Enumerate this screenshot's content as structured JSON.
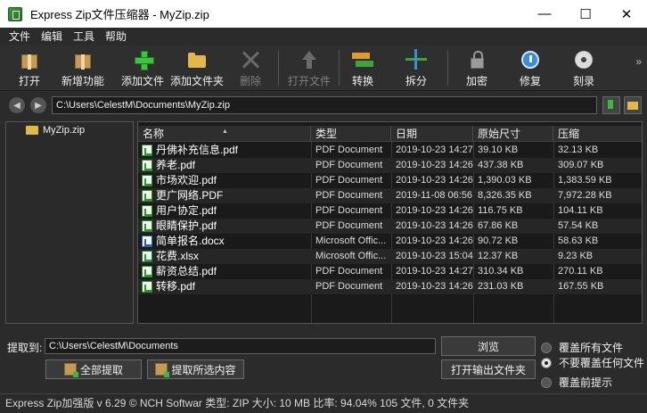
{
  "window": {
    "title": "Express Zip文件压缩器 - MyZip.zip",
    "minimize": "—",
    "maximize": "☐",
    "close": "✕"
  },
  "menu": [
    "文件",
    "编辑",
    "工具",
    "帮助"
  ],
  "toolbar": {
    "open": "打开",
    "new_features": "新增功能",
    "add_file": "添加文件",
    "add_folder": "添加文件夹",
    "delete": "删除",
    "open_file": "打开文件",
    "convert": "转换",
    "split": "拆分",
    "encrypt": "加密",
    "repair": "修复",
    "burn": "刻录",
    "more": "»"
  },
  "address": {
    "path": "C:\\Users\\CelestM\\Documents\\MyZip.zip",
    "back": "◀",
    "forward": "▶"
  },
  "tree": {
    "root": "MyZip.zip"
  },
  "columns": {
    "name": "名称",
    "type": "类型",
    "date": "日期",
    "original_size": "原始尺寸",
    "compressed": "压缩"
  },
  "files": [
    {
      "name": "丹佛补充信息.pdf",
      "type": "PDF Document",
      "date": "2019-10-23 14:27",
      "size": "39.10 KB",
      "compressed": "32.13 KB",
      "icon": "pdf"
    },
    {
      "name": "养老.pdf",
      "type": "PDF Document",
      "date": "2019-10-23 14:26",
      "size": "437.38 KB",
      "compressed": "309.07 KB",
      "icon": "pdf"
    },
    {
      "name": "市场欢迎.pdf",
      "type": "PDF Document",
      "date": "2019-10-23 14:26",
      "size": "1,390.03 KB",
      "compressed": "1,383.59 KB",
      "icon": "pdf"
    },
    {
      "name": "更广网络.PDF",
      "type": "PDF Document",
      "date": "2019-11-08 06:56",
      "size": "8,326.35 KB",
      "compressed": "7,972.28 KB",
      "icon": "pdf"
    },
    {
      "name": "用户协定.pdf",
      "type": "PDF Document",
      "date": "2019-10-23 14:26",
      "size": "116.75 KB",
      "compressed": "104.11 KB",
      "icon": "pdf"
    },
    {
      "name": "眼睛保护.pdf",
      "type": "PDF Document",
      "date": "2019-10-23 14:26",
      "size": "67.86 KB",
      "compressed": "57.54 KB",
      "icon": "pdf"
    },
    {
      "name": "简单报名.docx",
      "type": "Microsoft Offic...",
      "date": "2019-10-23 14:26",
      "size": "90.72 KB",
      "compressed": "58.63 KB",
      "icon": "doc"
    },
    {
      "name": "花费.xlsx",
      "type": "Microsoft Offic...",
      "date": "2019-10-23 15:04",
      "size": "12.37 KB",
      "compressed": "9.23 KB",
      "icon": "xls"
    },
    {
      "name": "薪资总结.pdf",
      "type": "PDF Document",
      "date": "2019-10-23 14:27",
      "size": "310.34 KB",
      "compressed": "270.11 KB",
      "icon": "pdf"
    },
    {
      "name": "转移.pdf",
      "type": "PDF Document",
      "date": "2019-10-23 14:26",
      "size": "231.03 KB",
      "compressed": "167.55 KB",
      "icon": "pdf"
    }
  ],
  "extract": {
    "label": "提取到:",
    "path": "C:\\Users\\CelestM\\Documents",
    "browse": "浏览",
    "open_output": "打开输出文件夹",
    "extract_all": "全部提取",
    "extract_selected": "提取所选内容"
  },
  "overwrite": {
    "all": "覆盖所有文件",
    "none": "不要覆盖任何文件",
    "prompt": "覆盖前提示",
    "selected": "none"
  },
  "status": "Express Zip加强版 v 6.29 © NCH Softwar 类型:  ZIP 大小: 10 MB 比率: 94.04% 105 文件, 0 文件夹"
}
